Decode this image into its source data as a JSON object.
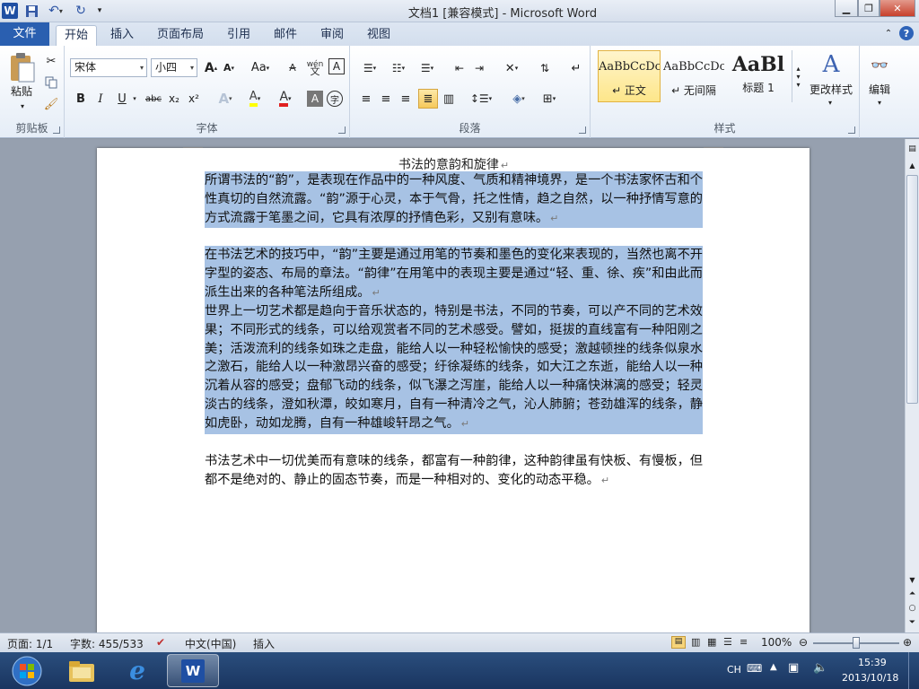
{
  "window": {
    "title": "文档1 [兼容模式] - Microsoft Word",
    "logo": "W"
  },
  "quick_access": {
    "save": "save-icon",
    "undo": "undo-icon",
    "redo": "redo-icon",
    "customize": "customize-icon"
  },
  "tabs": [
    {
      "label": "文件"
    },
    {
      "label": "开始"
    },
    {
      "label": "插入"
    },
    {
      "label": "页面布局"
    },
    {
      "label": "引用"
    },
    {
      "label": "邮件"
    },
    {
      "label": "审阅"
    },
    {
      "label": "视图"
    }
  ],
  "ribbon": {
    "clipboard": {
      "label": "剪贴板",
      "paste": "粘贴"
    },
    "font": {
      "label": "字体",
      "family": "宋体",
      "size": "小四",
      "grow": "A",
      "shrink": "A",
      "change_case": "Aa",
      "bold": "B",
      "italic": "I",
      "underline": "U",
      "strike": "abc",
      "subscript": "x₂",
      "superscript": "x²",
      "color": "A",
      "highlight": "A",
      "char_shade": "A",
      "enclose": "字",
      "text_effect": "A",
      "clear": "A",
      "phonetic": "wén",
      "border": "A"
    },
    "paragraph": {
      "label": "段落"
    },
    "styles": {
      "label": "样式",
      "items": [
        {
          "sample": "AaBbCcDc",
          "name": "↵ 正文"
        },
        {
          "sample": "AaBbCcDc",
          "name": "↵ 无间隔"
        },
        {
          "sample": "AaBl",
          "name": "标题 1"
        }
      ],
      "change_styles": "更改样式"
    },
    "editing": {
      "label": "编辑"
    }
  },
  "document": {
    "title": "书法的意韵和旋律",
    "paragraphs": [
      {
        "text": "所谓书法的“韵”，是表现在作品中的一种风度、气质和精神境界，是一个书法家怀古和个性真切的自然流露。“韵”源于心灵，本于气骨，托之性情，趋之自然，以一种抒情写意的方式流露于笔墨之间，它具有浓厚的抒情色彩，又别有意味。"
      },
      {
        "text": "在书法艺术的技巧中，“韵”主要是通过用笔的节奏和墨色的变化来表现的，当然也离不开字型的姿态、布局的章法。“韵律”在用笔中的表现主要是通过“轻、重、徐、疾”和由此而派生出来的各种笔法所组成。"
      },
      {
        "text": "世界上一切艺术都是趋向于音乐状态的，特别是书法，不同的节奏，可以产不同的艺术效果；不同形式的线条，可以给观赏者不同的艺术感受。譬如，挺拔的直线富有一种阳刚之美；活泼流利的线条如珠之走盘，能给人以一种轻松愉快的感受；激越顿挫的线条似泉水之激石，能给人以一种激昂兴奋的感受；纡徐凝练的线条，如大江之东逝，能给人以一种沉着从容的感受；盘郁飞动的线条，似飞瀑之泻崖，能给人以一种痛快淋漓的感受；轻灵淡古的线条，澄如秋潭，皎如寒月，自有一种清冷之气，沁人肺腑；苍劲雄浑的线条，静如虎卧，动如龙腾，自有一种雄峻轩昂之气。"
      },
      {
        "text": "书法艺术中一切优美而有意味的线条，都富有一种韵律，这种韵律虽有快板、有慢板，但都不是绝对的、静止的固态节奏，而是一种相对的、变化的动态平稳。"
      }
    ],
    "para_mark": "↵"
  },
  "status": {
    "page": "页面: 1/1",
    "words": "字数: 455/533",
    "language": "中文(中国)",
    "mode": "插入",
    "zoom": "100%"
  },
  "taskbar": {
    "lang": "CH",
    "time": "15:39",
    "date": "2013/10/18"
  }
}
